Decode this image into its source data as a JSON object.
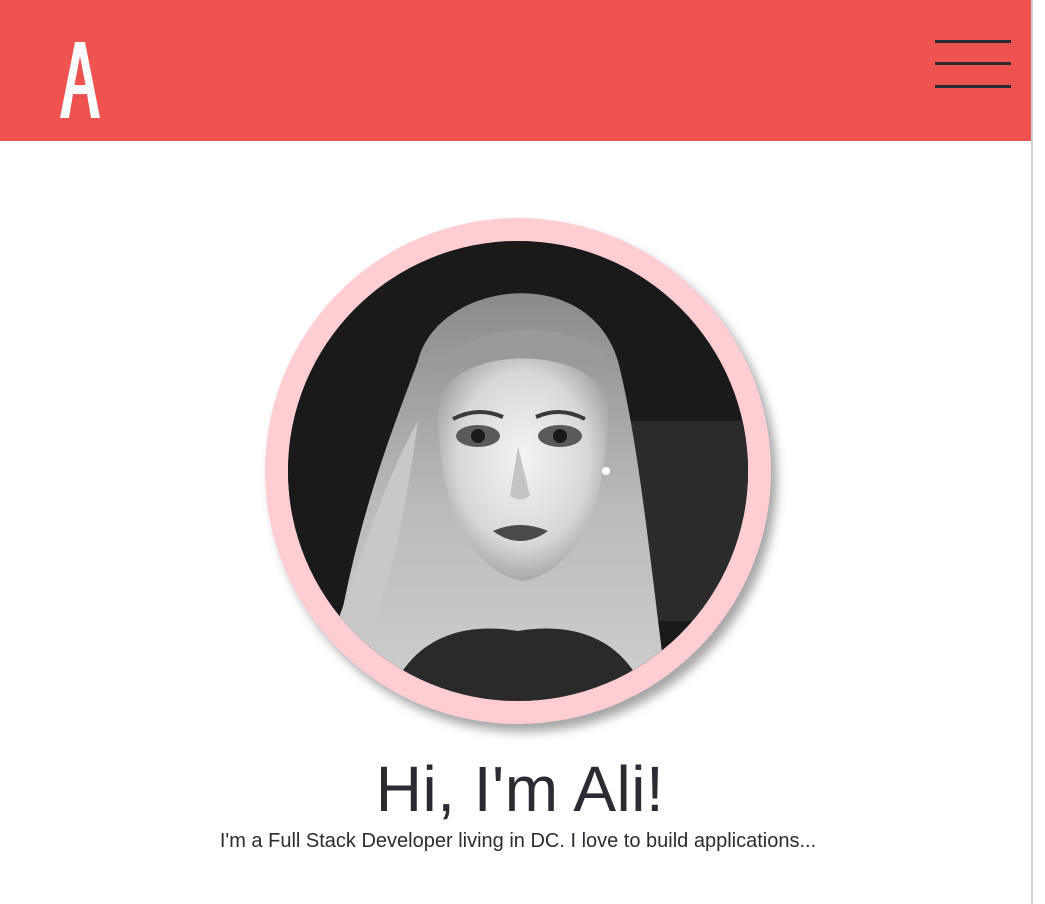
{
  "header": {
    "background_color": "#ef5350",
    "logo_text": "A",
    "menu_icon": "hamburger-menu-icon"
  },
  "profile": {
    "ring_color": "#ffcdd2",
    "photo": "black-and-white-portrait"
  },
  "hero": {
    "title": "Hi, I'm Ali!",
    "subtitle": "I'm a Full Stack Developer living in DC. I love to build applications..."
  }
}
